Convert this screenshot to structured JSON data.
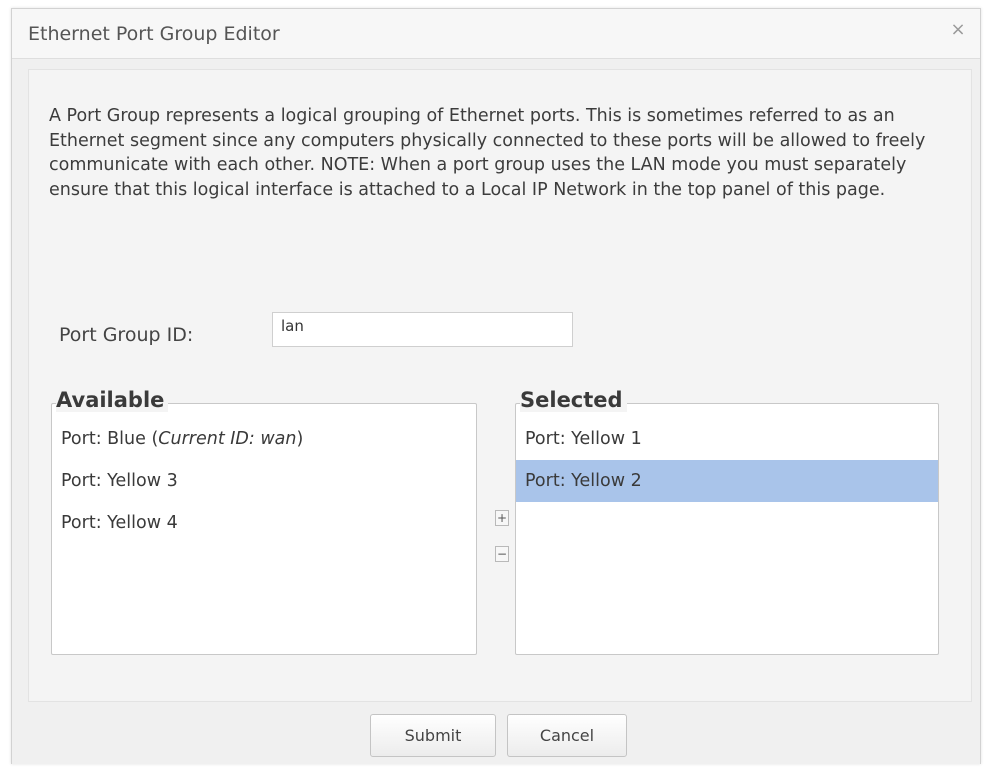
{
  "dialog": {
    "title": "Ethernet Port Group Editor",
    "close_glyph": "×",
    "description": "A Port Group represents a logical grouping of Ethernet ports. This is sometimes referred to as an Ethernet segment since any computers physically connected to these ports will be allowed to freely communicate with each other. NOTE: When a port group uses the LAN mode you must separately ensure that this logical interface is attached to a Local IP Network in the top panel of this page."
  },
  "port_group": {
    "label": "Port Group ID:",
    "value": "lan"
  },
  "available": {
    "legend": "Available",
    "items": [
      {
        "prefix": "Port: Blue (",
        "italic": "Current ID: wan",
        "suffix": ")"
      },
      {
        "prefix": "Port: Yellow 3",
        "italic": "",
        "suffix": ""
      },
      {
        "prefix": "Port: Yellow 4",
        "italic": "",
        "suffix": ""
      }
    ]
  },
  "selected": {
    "legend": "Selected",
    "items": [
      {
        "label": "Port: Yellow 1",
        "selected": false
      },
      {
        "label": "Port: Yellow 2",
        "selected": true
      }
    ]
  },
  "controls": {
    "add_label": "+",
    "remove_label": "−"
  },
  "footer": {
    "submit_label": "Submit",
    "cancel_label": "Cancel"
  },
  "colors": {
    "selection_highlight": "#a9c4ea",
    "dialog_background": "#f0f0f0"
  }
}
